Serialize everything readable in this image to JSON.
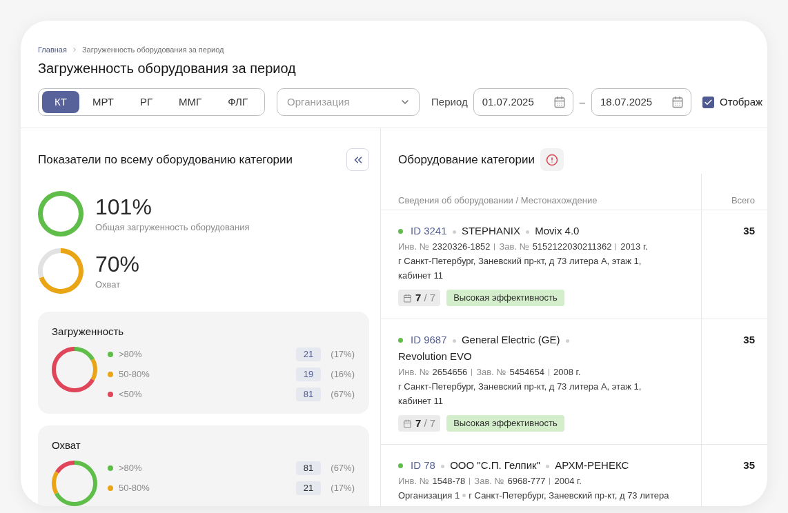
{
  "breadcrumb": [
    {
      "label": "Главная",
      "kind": "link"
    },
    {
      "label": "Загруженность оборудования за период",
      "kind": "current"
    }
  ],
  "title": "Загруженность оборудования за период",
  "filters": {
    "modality_tabs": [
      {
        "label": "КТ",
        "selected": true
      },
      {
        "label": "МРТ",
        "selected": false
      },
      {
        "label": "РГ",
        "selected": false
      },
      {
        "label": "ММГ",
        "selected": false
      },
      {
        "label": "ФЛГ",
        "selected": false
      }
    ],
    "organization": {
      "placeholder": "Организация"
    },
    "period": {
      "label": "Период",
      "from": "01.07.2025",
      "separator": "–",
      "to": "18.07.2025"
    },
    "display_option": {
      "label": "Отображ",
      "checked": true
    }
  },
  "summary": {
    "title": "Показатели по всему оборудованию категории",
    "metrics": [
      {
        "value": "101%",
        "label": "Общая загруженность оборудования",
        "color": "#5fbd49",
        "level": 1
      },
      {
        "value": "70%",
        "label": "Охват",
        "color": "#e9a515",
        "chart_data": {
          "type": "donut",
          "values": [
            70,
            30
          ]
        }
      }
    ],
    "breakdowns": [
      {
        "title": "Загруженность",
        "chart_data": {
          "type": "donut",
          "values": [
            17,
            16,
            67
          ]
        },
        "legend": [
          {
            "label": ">80%",
            "color": "#5fbd49",
            "count": "21",
            "share": "(17%)",
            "highlighted": true
          },
          {
            "label": "50-80%",
            "color": "#e9a515",
            "count": "19",
            "share": "(16%)",
            "highlighted": true
          },
          {
            "label": "<50%",
            "color": "#e0465a",
            "count": "81",
            "share": "(67%)",
            "highlighted": true
          }
        ]
      },
      {
        "title": "Охват",
        "chart_data": {
          "type": "donut",
          "values": [
            67,
            17,
            16
          ]
        },
        "legend": [
          {
            "label": ">80%",
            "color": "#5fbd49",
            "count": "81",
            "share": "(67%)",
            "highlighted": false
          },
          {
            "label": "50-80%",
            "color": "#e9a515",
            "count": "21",
            "share": "(17%)",
            "highlighted": false
          }
        ]
      }
    ]
  },
  "equipment": {
    "title": "Оборудование категории",
    "columns": [
      "Сведения об оборудовании / Местонахождение",
      "Всего"
    ],
    "rows": [
      {
        "color": "#5fbd49",
        "title_parts": [
          {
            "kind": "id",
            "text": "ID 3241"
          },
          {
            "kind": "name",
            "text": "STEPHANIX"
          },
          {
            "kind": "name",
            "text": "Movix 4.0"
          }
        ],
        "specs": [
          {
            "label": "Инв. №",
            "value": "2320326-1852"
          },
          {
            "label": "Зав. №",
            "value": "5152122030211362"
          },
          {
            "value": "2013 г."
          }
        ],
        "address": "г Санкт-Петербург, Заневский пр-кт, д 73 литера А, этаж 1, кабинет 11",
        "schedule": "**7** / 7",
        "efficiency": "Высокая эффективность",
        "total": "35"
      },
      {
        "color": "#5fbd49",
        "title_parts": [
          {
            "kind": "id",
            "text": "ID 9687"
          },
          {
            "kind": "name",
            "text": "General Electric (GE)"
          },
          {
            "kind": "name",
            "text": "Revolution EVO"
          }
        ],
        "specs": [
          {
            "label": "Инв. №",
            "value": "2654656"
          },
          {
            "label": "Зав. №",
            "value": "5454654"
          },
          {
            "value": "2008 г."
          }
        ],
        "address": "г Санкт-Петербург, Заневский пр-кт, д 73 литера А, этаж 1, кабинет 11",
        "schedule": "**7** / 7",
        "efficiency": "Высокая эффективность",
        "total": "35"
      },
      {
        "color": "#5fbd49",
        "title_parts": [
          {
            "kind": "id",
            "text": "ID 78"
          },
          {
            "kind": "name",
            "text": "ООО \"С.П. Гелпик\""
          },
          {
            "kind": "name",
            "text": "АРХМ-РЕНЕКС"
          }
        ],
        "specs": [
          {
            "label": "Инв. №",
            "value": "1548-78"
          },
          {
            "label": "Зав. №",
            "value": "6968-777"
          },
          {
            "value": "2004 г."
          }
        ],
        "organization": "Организация 1",
        "address": "г Санкт-Петербург, Заневский пр-кт, д 73 литера",
        "total": "35"
      }
    ]
  }
}
